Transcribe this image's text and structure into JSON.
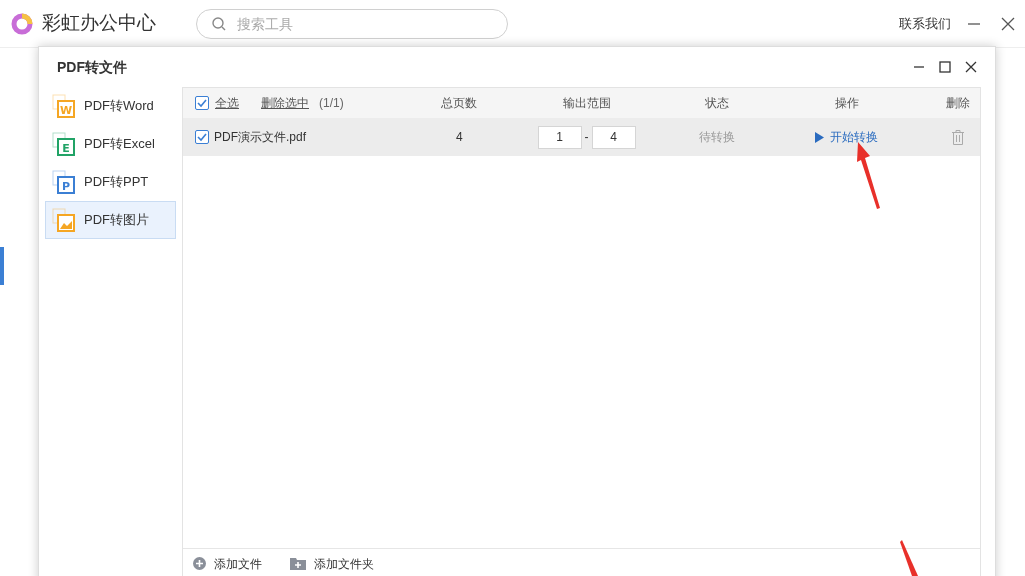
{
  "app": {
    "title": "彩虹办公中心",
    "search": {
      "placeholder": "搜索工具"
    },
    "contact": "联系我们"
  },
  "dialog": {
    "title": "PDF转文件",
    "menu": [
      {
        "label": "PDF转Word",
        "letter": "W",
        "color": "#f5a623",
        "selected": false
      },
      {
        "label": "PDF转Excel",
        "letter": "E",
        "color": "#21a366",
        "selected": false
      },
      {
        "label": "PDF转PPT",
        "letter": "P",
        "color": "#3b7fd4",
        "selected": false
      },
      {
        "label": "PDF转图片",
        "color": "#f5a623",
        "selected": true
      }
    ],
    "toolbar": {
      "select_all": {
        "label": "全选",
        "checked": true
      },
      "delete_selected": "删除选中",
      "count": "(1/1)"
    },
    "columns": [
      "总页数",
      "输出范围",
      "状态",
      "操作",
      "删除"
    ],
    "rows": [
      {
        "checked": true,
        "file": "PDF演示文件.pdf",
        "pages": "4",
        "from": "1",
        "separator": "-",
        "to": "4",
        "status": "待转换",
        "action": "开始转换"
      }
    ],
    "footer": [
      "添加文件",
      "添加文件夹"
    ]
  }
}
